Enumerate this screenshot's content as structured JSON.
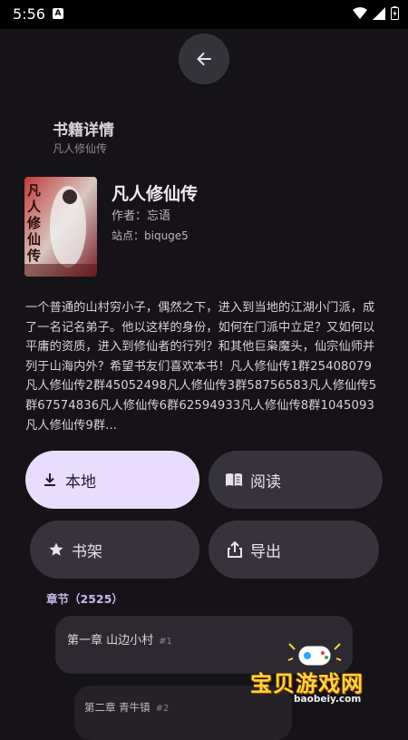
{
  "status_bar": {
    "time": "5:56",
    "notification_badge": "A"
  },
  "header": {
    "title": "书籍详情",
    "subtitle": "凡人修仙传"
  },
  "book": {
    "title": "凡人修仙传",
    "author": "作者：忘语",
    "site": "站点：biquge5",
    "cover_text": "凡人修仙传",
    "intro": "一个普通的山村穷小子，偶然之下，进入到当地的江湖小门派，成了一名记名弟子。他以这样的身份，如何在门派中立足？又如何以平庸的资质，进入到修仙者的行列？和其他巨枭魔头，仙宗仙师并列于山海内外？希望书友们喜欢本书！凡人修仙传1群25408079凡人修仙传2群45052498凡人修仙传3群58756583凡人修仙传5群67574836凡人修仙传6群62594933凡人修仙传8群1045093凡人修仙传9群..."
  },
  "actions": {
    "local": "本地",
    "read": "阅读",
    "shelf": "书架",
    "export": "导出"
  },
  "chapters": {
    "header": "章节（2525）",
    "items": [
      {
        "title": "第一章 山边小村",
        "index": "#1"
      },
      {
        "title": "第二章 青牛镇",
        "index": "#2"
      }
    ]
  },
  "watermark": {
    "text": "宝贝游戏网",
    "url": "baobeiy.com"
  },
  "colors": {
    "background": "#151317",
    "accent_button": "#e9ddff",
    "surface": "#37333c",
    "chapter_header": "#c9b8f0"
  }
}
